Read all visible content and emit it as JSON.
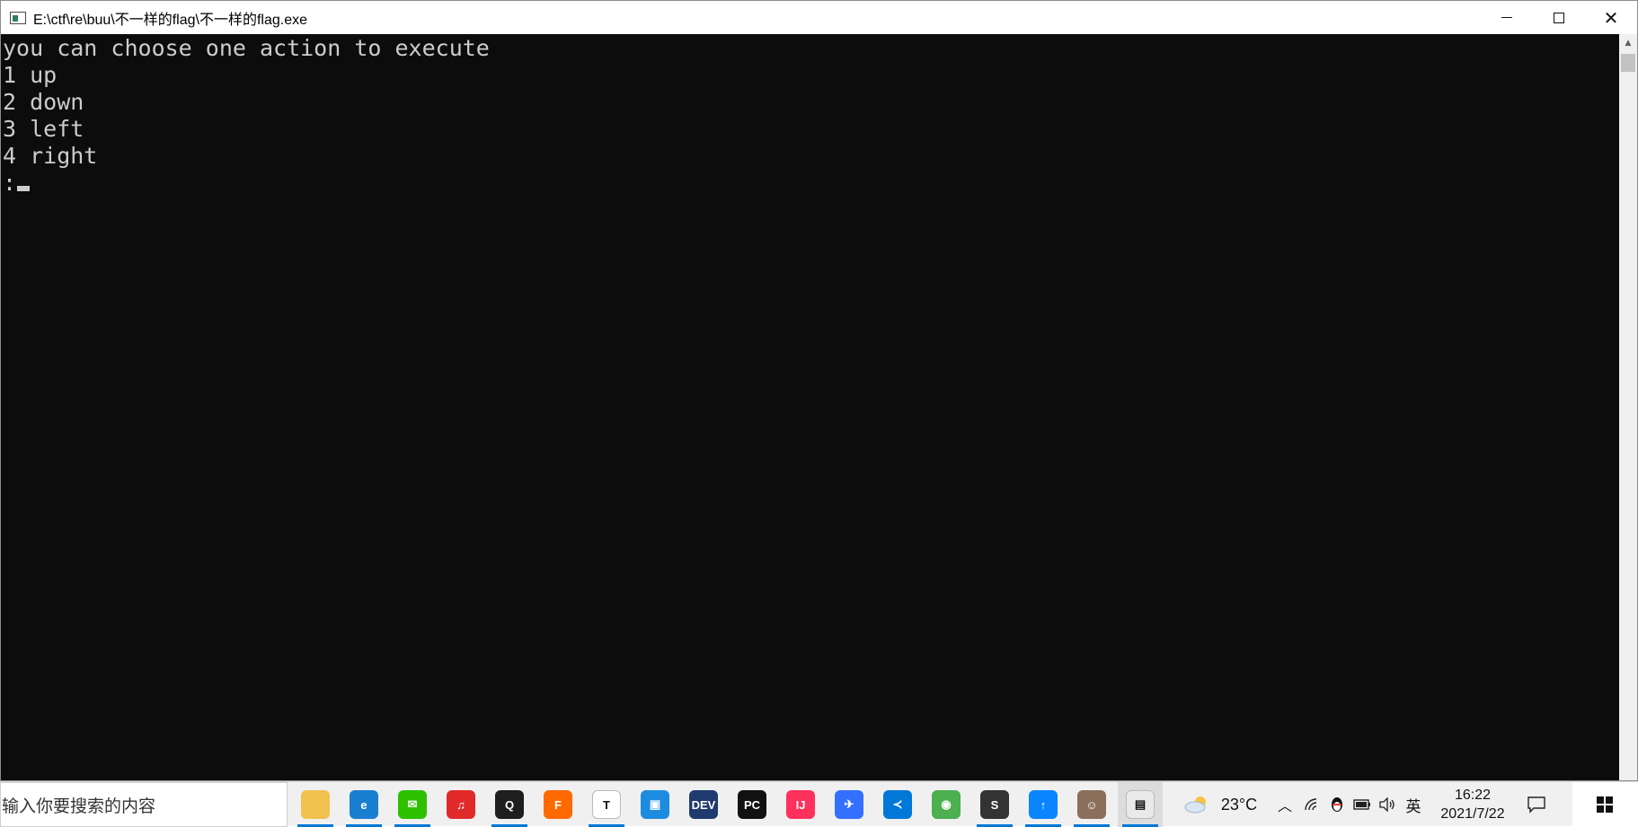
{
  "window": {
    "title": "E:\\ctf\\re\\buu\\不一样的flag\\不一样的flag.exe",
    "controls": {
      "minimize": "—",
      "maximize": "☐",
      "close": "✕"
    }
  },
  "console": {
    "lines": [
      "you can choose one action to execute",
      "1 up",
      "2 down",
      "3 left",
      "4 right"
    ],
    "prompt": ":"
  },
  "taskbar": {
    "search_placeholder": "输入你要搜索的内容",
    "apps": [
      {
        "name": "file-explorer",
        "glyph": "",
        "color": "#f2c14e",
        "running": true
      },
      {
        "name": "edge",
        "glyph": "e",
        "color": "#1a7fd1",
        "running": true
      },
      {
        "name": "wechat",
        "glyph": "✉",
        "color": "#2dc100",
        "running": true
      },
      {
        "name": "netease-music",
        "glyph": "♫",
        "color": "#e02a2a",
        "running": false
      },
      {
        "name": "qq",
        "glyph": "Q",
        "color": "#1e1e1e",
        "running": true
      },
      {
        "name": "firefox",
        "glyph": "F",
        "color": "#ff6a00",
        "running": false
      },
      {
        "name": "typora",
        "glyph": "T",
        "color": "#ffffff",
        "running": true
      },
      {
        "name": "vmware",
        "glyph": "▣",
        "color": "#1d8ce0",
        "running": false
      },
      {
        "name": "dev-cpp",
        "glyph": "DEV",
        "color": "#1f3a6e",
        "running": false
      },
      {
        "name": "pycharm",
        "glyph": "PC",
        "color": "#111111",
        "running": false
      },
      {
        "name": "intellij-idea",
        "glyph": "IJ",
        "color": "#fe315d",
        "running": false
      },
      {
        "name": "feishu",
        "glyph": "✈",
        "color": "#3370ff",
        "running": false
      },
      {
        "name": "vscode",
        "glyph": "≺",
        "color": "#0078d7",
        "running": false
      },
      {
        "name": "chrome",
        "glyph": "◉",
        "color": "#4caf50",
        "running": false
      },
      {
        "name": "sublime-text",
        "glyph": "S",
        "color": "#333333",
        "running": true
      },
      {
        "name": "upgrade-helper",
        "glyph": "↑",
        "color": "#0a84ff",
        "running": true
      },
      {
        "name": "photo-viewer",
        "glyph": "☺",
        "color": "#8b6f5a",
        "running": true
      },
      {
        "name": "console-app",
        "glyph": "▤",
        "color": "#e9e9e9",
        "running": true
      }
    ],
    "weather": "23°C",
    "ime": "英",
    "time": "16:22",
    "date": "2021/7/22"
  }
}
